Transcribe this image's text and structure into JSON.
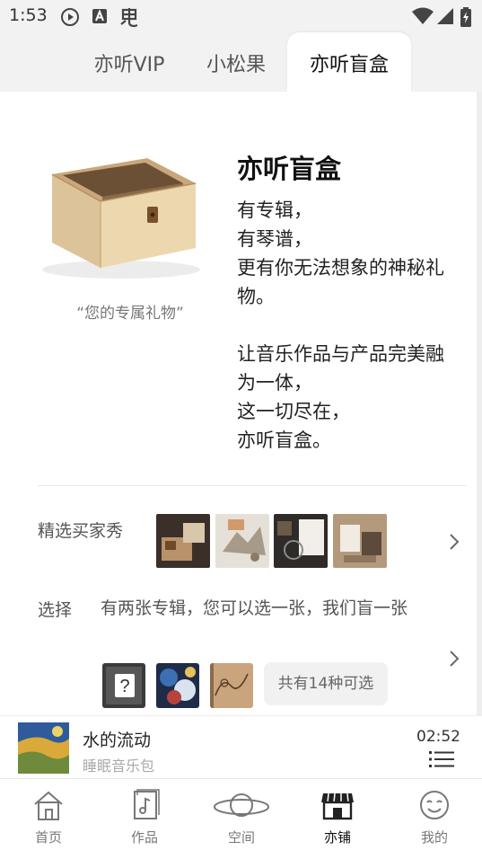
{
  "status_bar": {
    "time": "1:53",
    "left_icons": [
      "play-circle-icon",
      "a-badge-icon",
      "chinese-char-icon"
    ],
    "right_icons": [
      "wifi-icon",
      "signal-icon",
      "battery-charging-icon"
    ]
  },
  "tabs": [
    {
      "label": "亦听VIP",
      "active": false
    },
    {
      "label": "小松果",
      "active": false
    },
    {
      "label": "亦听盲盒",
      "active": true
    }
  ],
  "hero": {
    "caption": "“您的专属礼物”",
    "title": "亦听盲盒",
    "lines": [
      "有专辑，",
      "有琴谱，",
      "更有你无法想象的神秘礼物。"
    ],
    "lines2": [
      "让音乐作品与产品完美融为一体，",
      "这一切尽在，",
      "亦听盲盒。"
    ]
  },
  "buyer_show": {
    "label": "精选买家秀",
    "photos": [
      "buyer-photo-1",
      "buyer-photo-2",
      "buyer-photo-3",
      "buyer-photo-4"
    ]
  },
  "choose": {
    "label": "选择",
    "text": "有两张专辑，您可以选一张，我们盲一张",
    "albums": [
      "mystery-album",
      "album-blue-painting",
      "album-tan-sketch"
    ],
    "available": "共有14种可选"
  },
  "player": {
    "title": "水的流动",
    "subtitle": "睡眠音乐包",
    "time": "02:52"
  },
  "bottom_nav": [
    {
      "label": "首页",
      "icon": "house-icon",
      "active": false
    },
    {
      "label": "作品",
      "icon": "music-note-icon",
      "active": false
    },
    {
      "label": "空间",
      "icon": "planet-icon",
      "active": false
    },
    {
      "label": "亦铺",
      "icon": "shop-icon",
      "active": true
    },
    {
      "label": "我的",
      "icon": "smiley-icon",
      "active": false
    }
  ],
  "colors": {
    "status_bg": "#f2f2f2",
    "text_primary": "#111111",
    "text_secondary": "#555555",
    "text_muted": "#777777",
    "pill_bg": "#f1f1f1"
  }
}
